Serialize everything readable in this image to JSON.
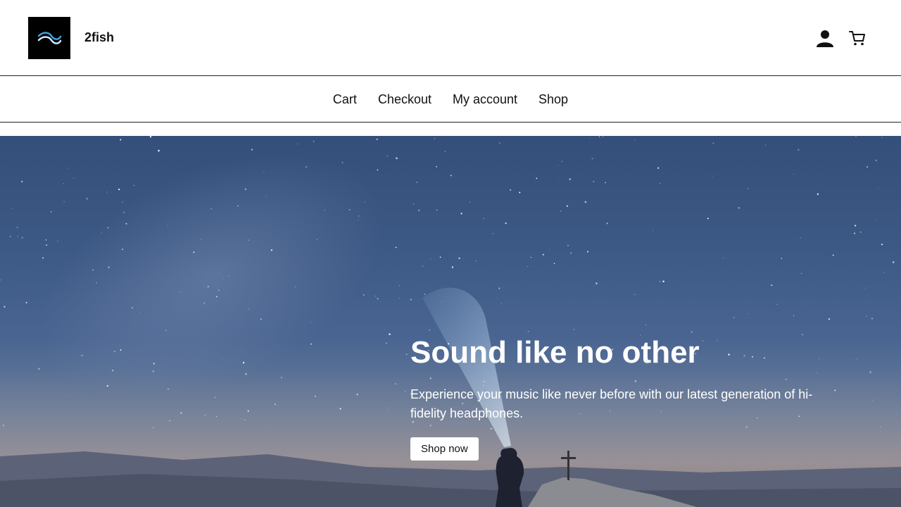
{
  "header": {
    "site_name": "2fish",
    "logo_icon": "fish-logo-icon",
    "account_icon": "user-icon",
    "cart_icon": "cart-icon"
  },
  "nav": {
    "items": [
      {
        "label": "Cart"
      },
      {
        "label": "Checkout"
      },
      {
        "label": "My account"
      },
      {
        "label": "Shop"
      }
    ]
  },
  "hero": {
    "title": "Sound like no other",
    "subtitle": "Experience your music like never before with our latest generation of hi-fidelity headphones.",
    "button_label": "Shop now"
  },
  "colors": {
    "logo_background": "#000000",
    "hero_sky": "#3c5884",
    "text_dark": "#111111",
    "text_light": "#ffffff"
  }
}
